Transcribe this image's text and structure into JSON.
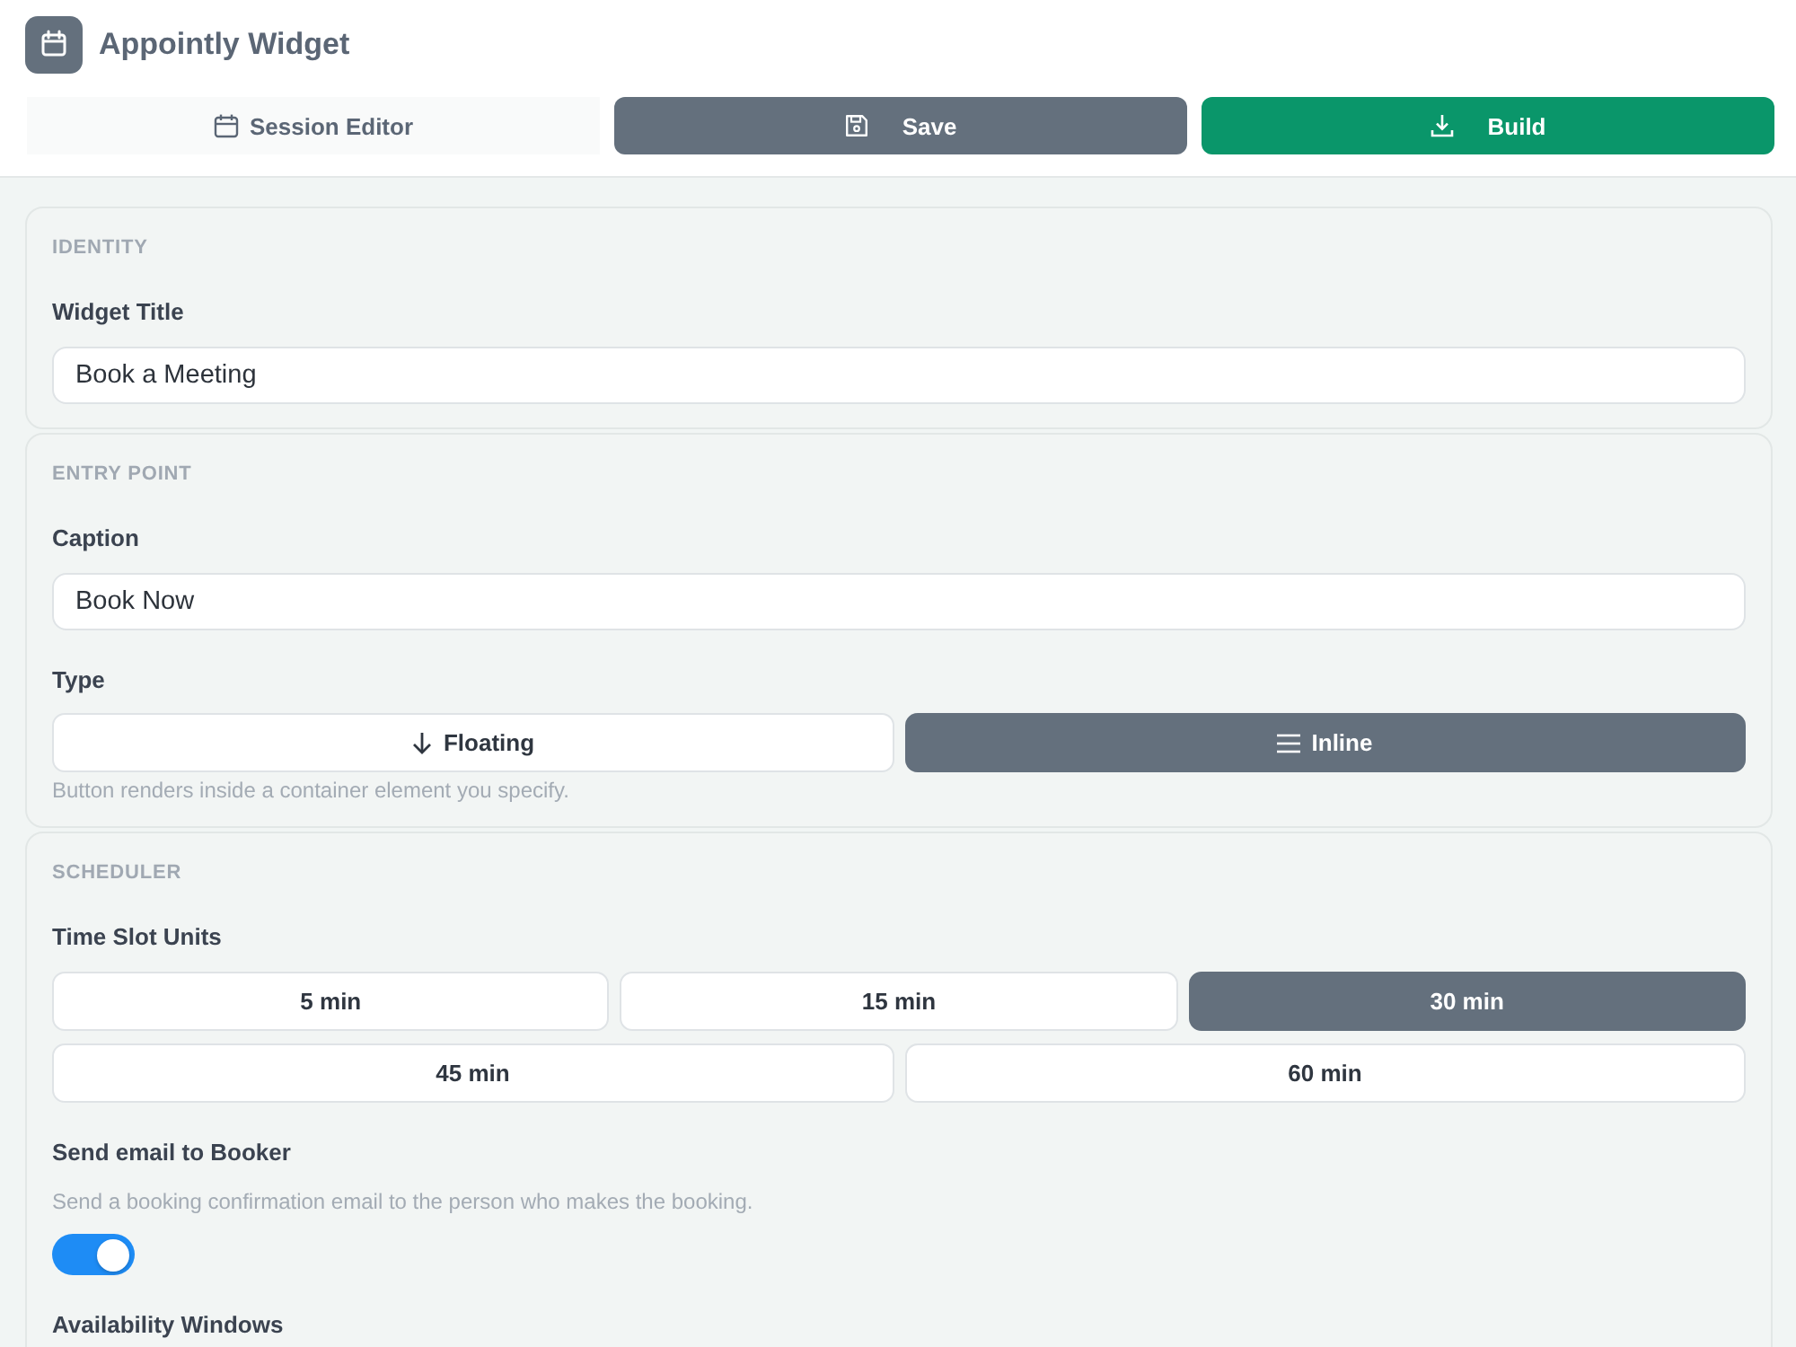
{
  "header": {
    "title": "Appointly Widget"
  },
  "toolbar": [
    {
      "kind": "tab",
      "label": "Session Editor"
    },
    {
      "kind": "secondary",
      "label": "Save"
    },
    {
      "kind": "primary",
      "label": "Build"
    }
  ],
  "sections": [
    {
      "title": "IDENTITY",
      "fields": [
        {
          "kind": "text",
          "label": "Widget Title",
          "value": "Book a Meeting"
        }
      ]
    },
    {
      "title": "ENTRY POINT",
      "fields": [
        {
          "kind": "text",
          "label": "Caption",
          "value": "Book Now"
        },
        {
          "kind": "segmented",
          "label": "Type",
          "options": [
            {
              "label": "Floating",
              "selected": false
            },
            {
              "label": "Inline",
              "selected": true
            }
          ],
          "hint": "Button renders inside a container element you specify."
        }
      ]
    },
    {
      "title": "SCHEDULER",
      "fields": [
        {
          "kind": "choices",
          "label": "Time Slot Units",
          "option_rows": [
            [
              {
                "label": "5 min",
                "selected": false
              },
              {
                "label": "15 min",
                "selected": false
              },
              {
                "label": "30 min",
                "selected": true
              }
            ],
            [
              {
                "label": "45 min",
                "selected": false
              },
              {
                "label": "60 min",
                "selected": false
              }
            ]
          ]
        },
        {
          "kind": "toggle",
          "label": "Send email to Booker",
          "description": "Send a booking confirmation email to the person who makes the booking.",
          "on": true
        },
        {
          "kind": "heading",
          "label": "Availability Windows"
        }
      ]
    }
  ]
}
